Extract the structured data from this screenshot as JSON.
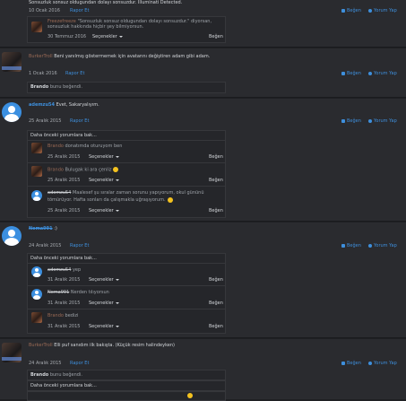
{
  "top": {
    "text1": "Sonsuzluk sonsuz oldugundan dolayı sonsuzdur. İlluminati Detected.",
    "date": "10 Ocak 2016",
    "report": "Rapor Et",
    "like": "Beğen",
    "comment": "Yorum Yap",
    "reply": {
      "author": "Freezefreeze",
      "text": "\"Sonsuzluk sonsuz oldugundan dolayı sonsuzdur.\" diyorsan, sonsuzluk hakkında hiçbir şey bilmiyorsun.",
      "date": "30 Temmuz 2016",
      "options": "Seçenekler",
      "like": "Beğen"
    }
  },
  "post1": {
    "author": "BurkerTroll",
    "text": "Beni yanılmış göstermemek için avatarını değiştiren adam gibi adam.",
    "date": "1 Ocak 2016",
    "report": "Rapor Et",
    "like": "Beğen",
    "comment": "Yorum Yap",
    "likes_user": "Brando",
    "likes_text": "bunu beğendi."
  },
  "post2": {
    "author": "ademzu54",
    "text": "Evet, Sakaryalıyım.",
    "date": "25 Aralık 2015",
    "report": "Rapor Et",
    "like": "Beğen",
    "comment": "Yorum Yap",
    "more": "Daha önceki yorumlara bak...",
    "replies": [
      {
        "author": "Brando",
        "text": "donatımda oturuyom ben",
        "date": "25 Aralık 2015",
        "options": "Seçenekler",
        "like": "Beğen"
      },
      {
        "author": "Brando",
        "text": "Bulugak ki ara çenliz",
        "date": "25 Aralık 2015",
        "options": "Seçenekler",
        "like": "Beğen"
      },
      {
        "author": "ademzu54",
        "text": "Maalesef şu sıralar zaman sorunu yapıyorum, okul gününü tömürüyor. Hafta sonları da çalışmakla uğraşıyorum.",
        "date": "25 Aralık 2015",
        "options": "Seçenekler",
        "like": "Beğen"
      }
    ]
  },
  "post3": {
    "author": "Nema991",
    "text": ":)",
    "date": "24 Aralık 2015",
    "report": "Rapor Et",
    "like": "Beğen",
    "comment": "Yorum Yap",
    "more": "Daha önceki yorumlara bak...",
    "replies": [
      {
        "author": "ademzu54",
        "text": "yep",
        "date": "31 Aralık 2015",
        "options": "Seçenekler",
        "like": "Beğen"
      },
      {
        "author": "Nema991",
        "text": "Nerden tılıyorsun",
        "date": "31 Aralık 2015",
        "options": "Seçenekler",
        "like": "Beğen"
      },
      {
        "author": "Brando",
        "text": "bedizi",
        "date": "31 Aralık 2015",
        "options": "Seçenekler",
        "like": "Beğen"
      }
    ]
  },
  "post4": {
    "author": "BurkerTroll",
    "text": "Elli puf sanıdım ilk bakışta. (Küçük resim halindeyken)",
    "date": "24 Aralık 2015",
    "report": "Rapor Et",
    "like": "Beğen",
    "comment": "Yorum Yap",
    "likes_user": "Brando",
    "likes_text": "bunu beğendi.",
    "more": "Daha önceki yorumlara bak..."
  }
}
